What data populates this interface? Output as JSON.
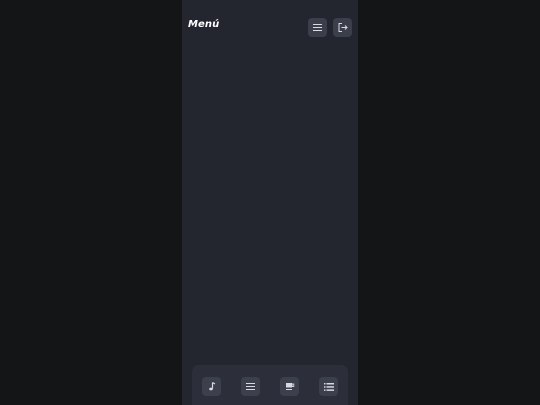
{
  "header": {
    "title": "Menú",
    "buttons": [
      {
        "id": "menu",
        "icon": "hamburger-icon"
      },
      {
        "id": "logout",
        "icon": "logout-icon"
      }
    ]
  },
  "bottom_nav": {
    "items": [
      {
        "id": "music",
        "icon": "music-note-icon"
      },
      {
        "id": "menu",
        "icon": "hamburger-icon"
      },
      {
        "id": "cafe",
        "icon": "coffee-cup-icon"
      },
      {
        "id": "list",
        "icon": "list-icon"
      }
    ]
  },
  "colors": {
    "background": "#141517",
    "panel": "#23252f",
    "button": "#3b3e4b",
    "nav_bar": "#2c2f3a",
    "text": "#ffffff",
    "icon": "#d8dae2"
  }
}
